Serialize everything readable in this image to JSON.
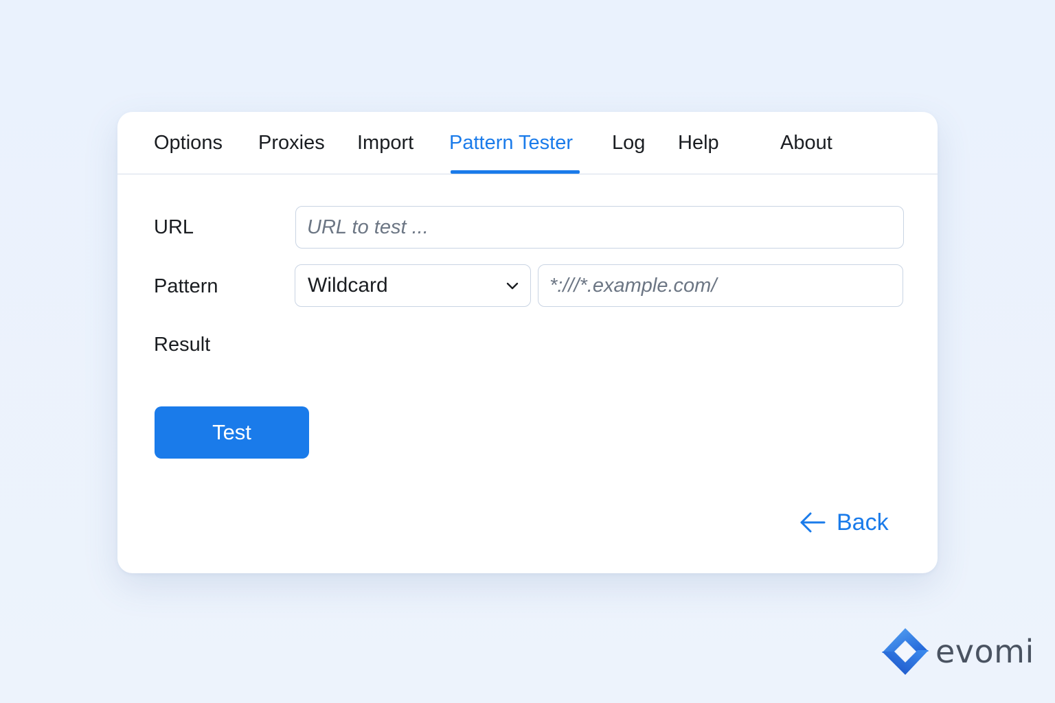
{
  "tabs": [
    {
      "label": "Options",
      "active": false
    },
    {
      "label": "Proxies",
      "active": false
    },
    {
      "label": "Import",
      "active": false
    },
    {
      "label": "Pattern Tester",
      "active": true
    },
    {
      "label": "Log",
      "active": false
    },
    {
      "label": "Help",
      "active": false
    },
    {
      "label": "About",
      "active": false
    }
  ],
  "form": {
    "url_label": "URL",
    "url_placeholder": "URL to test ...",
    "url_value": "",
    "pattern_label": "Pattern",
    "pattern_type_selected": "Wildcard",
    "pattern_placeholder": "*:///*.example.com/",
    "pattern_value": "",
    "result_label": "Result",
    "result_value": ""
  },
  "actions": {
    "test_label": "Test",
    "back_label": "Back"
  },
  "brand": {
    "name": "evomi"
  },
  "colors": {
    "accent": "#1a7bea",
    "background": "#eaf2fd",
    "card": "#ffffff",
    "border": "#c9d4e3",
    "text": "#1a1d21"
  },
  "icons": {
    "dropdown": "chevron-down-icon",
    "back": "arrow-left-icon",
    "logo": "evomi-logo-icon"
  }
}
